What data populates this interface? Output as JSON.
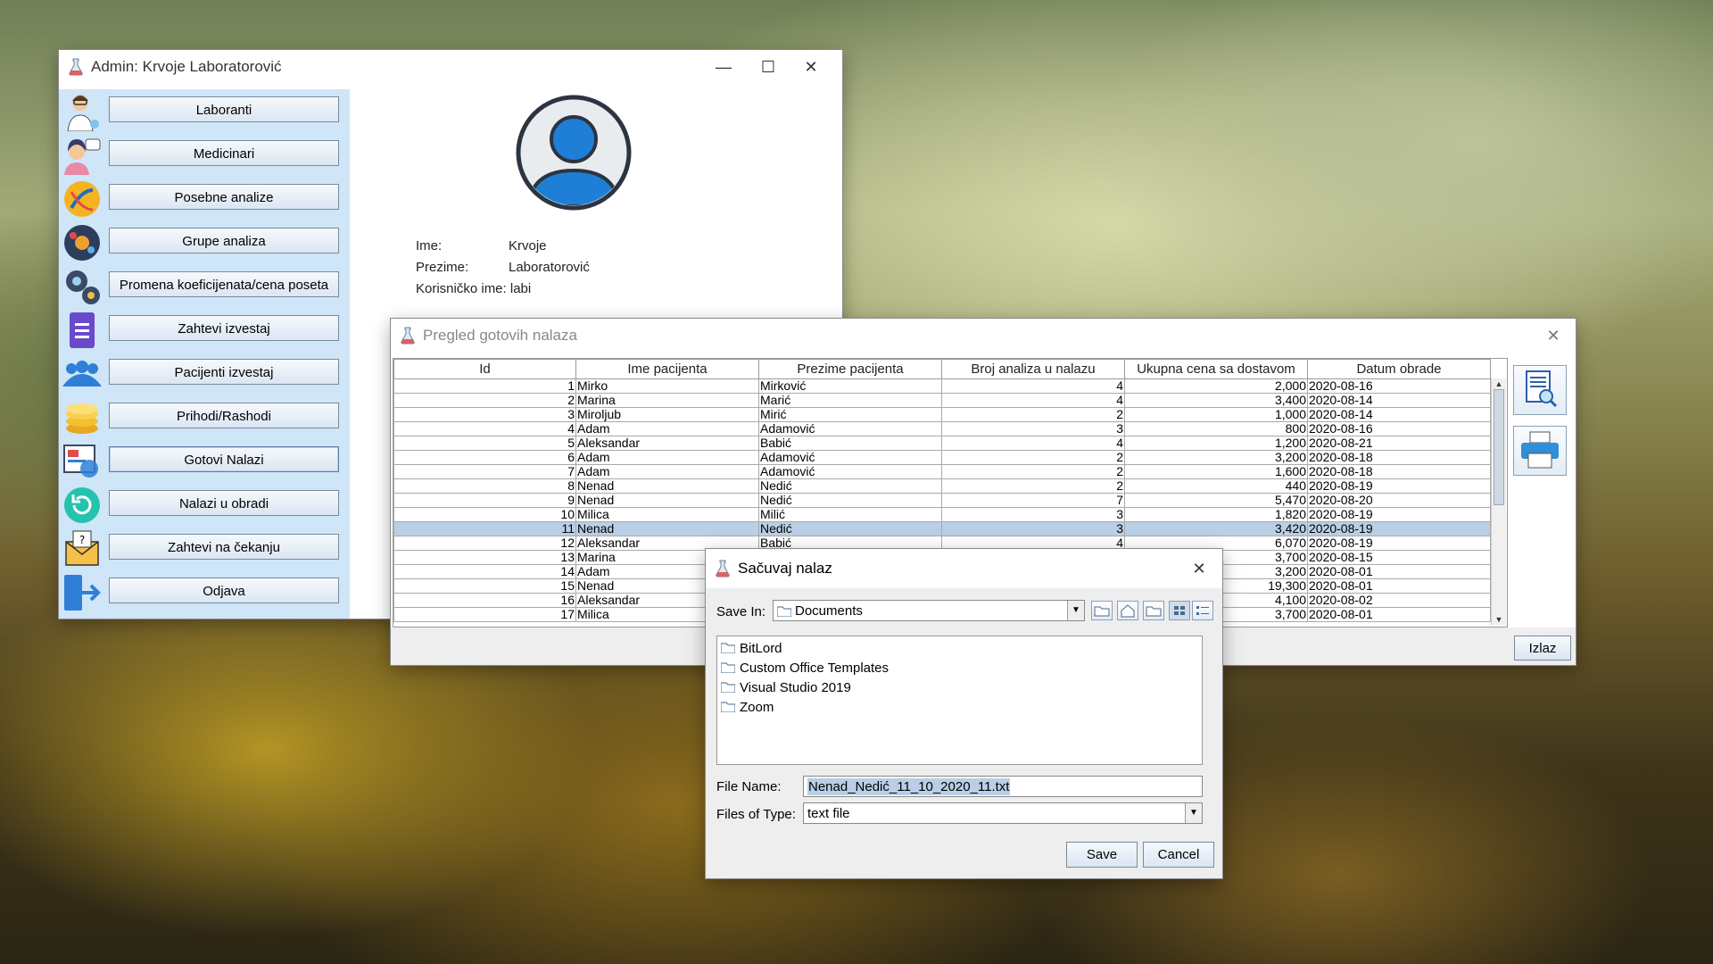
{
  "admin_window": {
    "title": "Admin: Krvoje Laboratorović",
    "menu": [
      {
        "label": "Laboranti",
        "icon": "lab-technician-icon"
      },
      {
        "label": "Medicinari",
        "icon": "nurse-icon"
      },
      {
        "label": "Posebne analize",
        "icon": "dna-icon"
      },
      {
        "label": "Grupe analiza",
        "icon": "analysis-groups-icon"
      },
      {
        "label": "Promena koeficijenata/cena poseta",
        "icon": "gears-icon"
      },
      {
        "label": "Zahtevi izvestaj",
        "icon": "form-document-icon"
      },
      {
        "label": "Pacijenti izvestaj",
        "icon": "patients-group-icon"
      },
      {
        "label": "Prihodi/Rashodi",
        "icon": "coins-icon"
      },
      {
        "label": "Gotovi Nalazi",
        "icon": "finished-results-icon"
      },
      {
        "label": "Nalazi u obradi",
        "icon": "refresh-icon"
      },
      {
        "label": "Zahtevi na čekanju",
        "icon": "waiting-request-icon"
      },
      {
        "label": "Odjava",
        "icon": "logout-icon"
      }
    ],
    "profile": {
      "ime_label": "Ime:",
      "ime": "Krvoje",
      "prezime_label": "Prezime:",
      "prezime": "Laboratorović",
      "username_label": "Korisničko ime:",
      "username": "labi"
    }
  },
  "results_window": {
    "title": "Pregled gotovih nalaza",
    "columns": [
      "Id",
      "Ime pacijenta",
      "Prezime pacijenta",
      "Broj analiza u nalazu",
      "Ukupna cena sa dostavom",
      "Datum obrade"
    ],
    "rows": [
      [
        "1",
        "Mirko",
        "Mirković",
        "4",
        "2,000",
        "2020-08-16"
      ],
      [
        "2",
        "Marina",
        "Marić",
        "4",
        "3,400",
        "2020-08-14"
      ],
      [
        "3",
        "Miroljub",
        "Mirić",
        "2",
        "1,000",
        "2020-08-14"
      ],
      [
        "4",
        "Adam",
        "Adamović",
        "3",
        "800",
        "2020-08-16"
      ],
      [
        "5",
        "Aleksandar",
        "Babić",
        "4",
        "1,200",
        "2020-08-21"
      ],
      [
        "6",
        "Adam",
        "Adamović",
        "2",
        "3,200",
        "2020-08-18"
      ],
      [
        "7",
        "Adam",
        "Adamović",
        "2",
        "1,600",
        "2020-08-18"
      ],
      [
        "8",
        "Nenad",
        "Nedić",
        "2",
        "440",
        "2020-08-19"
      ],
      [
        "9",
        "Nenad",
        "Nedić",
        "7",
        "5,470",
        "2020-08-20"
      ],
      [
        "10",
        "Milica",
        "Milić",
        "3",
        "1,820",
        "2020-08-19"
      ],
      [
        "11",
        "Nenad",
        "Nedić",
        "3",
        "3,420",
        "2020-08-19"
      ],
      [
        "12",
        "Aleksandar",
        "Babić",
        "4",
        "6,070",
        "2020-08-19"
      ],
      [
        "13",
        "Marina",
        "",
        "",
        "3,700",
        "2020-08-15"
      ],
      [
        "14",
        "Adam",
        "",
        "",
        "3,200",
        "2020-08-01"
      ],
      [
        "15",
        "Nenad",
        "",
        "",
        "19,300",
        "2020-08-01"
      ],
      [
        "16",
        "Aleksandar",
        "",
        "",
        "4,100",
        "2020-08-02"
      ],
      [
        "17",
        "Milica",
        "",
        "",
        "3,700",
        "2020-08-01"
      ]
    ],
    "selected_row": 11,
    "exit_label": "Izlaz",
    "tools": [
      "preview-document-icon",
      "printer-icon"
    ]
  },
  "save_dialog": {
    "title": "Sačuvaj nalaz",
    "save_in_label": "Save In:",
    "save_in_value": "Documents",
    "files": [
      "BitLord",
      "Custom Office Templates",
      "Visual Studio 2019",
      "Zoom"
    ],
    "file_name_label": "File Name:",
    "file_name_value": "Nenad_Nedić_11_10_2020_11.txt",
    "files_of_type_label": "Files of Type:",
    "files_of_type_value": "text file",
    "save_label": "Save",
    "cancel_label": "Cancel"
  },
  "colors": {
    "sidebar_bg": "#cfe5f8",
    "selected_row": "#b8cfe5",
    "avatar_blue": "#1f7fd6"
  }
}
